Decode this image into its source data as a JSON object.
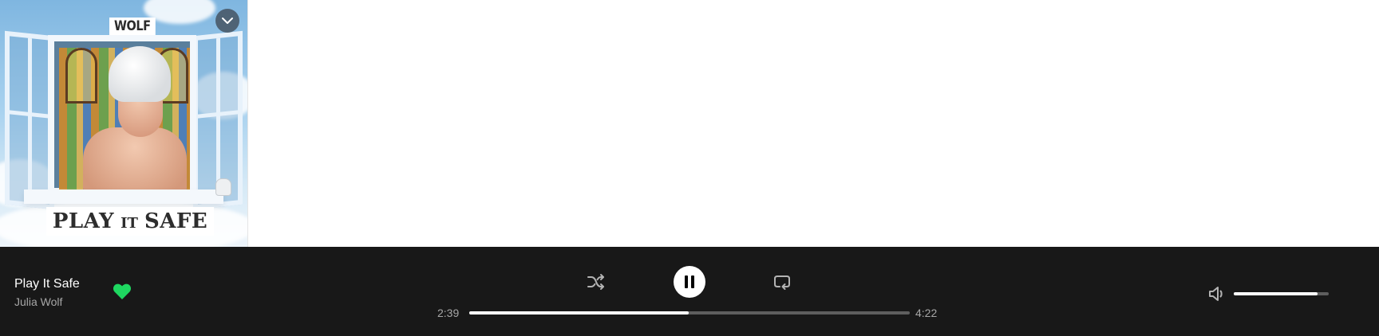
{
  "album_art": {
    "logo_text": "WOLF",
    "title_part1": "PLAY",
    "title_part2": "IT",
    "title_part3": "SAFE"
  },
  "now_playing": {
    "title": "Play It Safe",
    "artist": "Julia Wolf",
    "liked": true
  },
  "playback": {
    "elapsed": "2:39",
    "total": "4:22",
    "progress_fraction": 0.498,
    "state": "playing"
  },
  "volume": {
    "level_fraction": 0.88
  },
  "icons": {
    "collapse": "chevron-down-icon",
    "like": "heart-icon",
    "shuffle": "shuffle-icon",
    "pause": "pause-icon",
    "repeat": "repeat-icon",
    "volume": "speaker-icon"
  },
  "colors": {
    "player_bg": "#181818",
    "accent_green": "#1ed760",
    "secondary_text": "#a7a7a7",
    "track_bg": "#5e5e5e"
  }
}
